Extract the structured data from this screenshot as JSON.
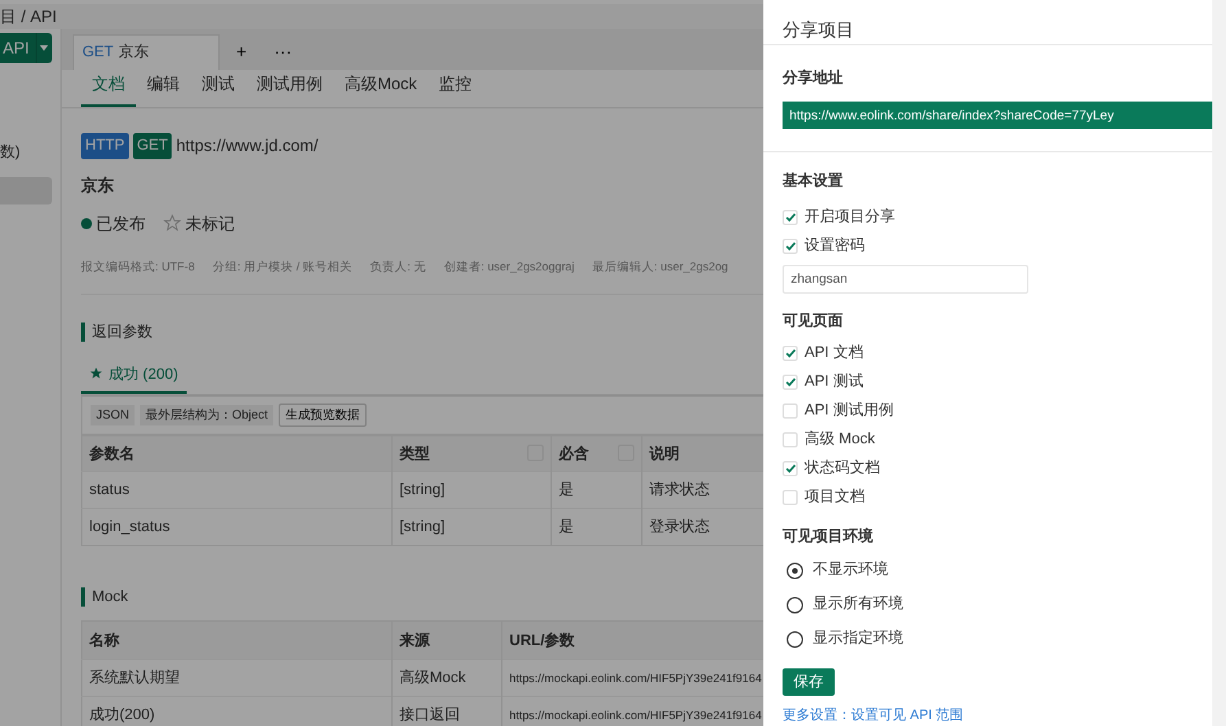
{
  "breadcrumb": "目 / API",
  "sidebar": {
    "button": "API",
    "items": [
      {
        "label": "数)",
        "selected": false
      },
      {
        "selected": true
      }
    ]
  },
  "doc_tabs": [
    {
      "method": "GET",
      "title": "京东",
      "selected": true
    }
  ],
  "tab_actions": [
    "+",
    "···"
  ],
  "sub_tabs": [
    {
      "label": "文档",
      "selected": true
    },
    {
      "label": "编辑",
      "selected": false
    },
    {
      "label": "测试",
      "selected": false
    },
    {
      "label": "测试用例",
      "selected": false
    },
    {
      "label": "高级Mock",
      "selected": false
    },
    {
      "label": "监控",
      "selected": false
    }
  ],
  "api": {
    "protocol": "HTTP",
    "method": "GET",
    "url": "https://www.jd.com/",
    "name": "京东",
    "status": "已发布",
    "star": "未标记",
    "starred": false,
    "meta": [
      "报文编码格式: UTF-8",
      "分组: 用户模块 / 账号相关",
      "负责人: 无",
      "创建者: user_2gs2oggraj",
      "最后编辑人: user_2gs2og"
    ]
  },
  "response": {
    "title": "返回参数",
    "tabs": [
      {
        "label": "成功 (200)",
        "selected": true
      }
    ],
    "tags": [
      "JSON",
      "最外层结构为：Object"
    ],
    "button": "生成预览数据",
    "columns": [
      {
        "label": "参数名",
        "sortable": false
      },
      {
        "label": "类型",
        "sortable": true
      },
      {
        "label": "必含",
        "sortable": true
      },
      {
        "label": "说明",
        "sortable": false
      }
    ],
    "rows": [
      [
        "status",
        "[string]",
        "是",
        "请求状态"
      ],
      [
        "login_status",
        "[string]",
        "是",
        "登录状态"
      ]
    ]
  },
  "mock": {
    "title": "Mock",
    "columns": [
      "名称",
      "来源",
      "URL/参数"
    ],
    "rows": [
      [
        "系统默认期望",
        "高级Mock",
        "https://mockapi.eolink.com/HIF5PjY39e241f9164"
      ],
      [
        "成功(200)",
        "接口返回",
        "https://mockapi.eolink.com/HIF5PjY39e241f9164"
      ]
    ]
  },
  "drawer": {
    "title": "分享项目",
    "address_label": "分享地址",
    "address": "https://www.eolink.com/share/index?shareCode=77yLey",
    "basic_title": "基本设置",
    "basic": [
      {
        "label": "开启项目分享",
        "checked": true
      },
      {
        "label": "设置密码",
        "checked": true
      }
    ],
    "password": "zhangsan",
    "pages_title": "可见页面",
    "pages": [
      {
        "label": "API 文档",
        "checked": true
      },
      {
        "label": "API 测试",
        "checked": true
      },
      {
        "label": "API 测试用例",
        "checked": false
      },
      {
        "label": "高级 Mock",
        "checked": false
      },
      {
        "label": "状态码文档",
        "checked": true
      },
      {
        "label": "项目文档",
        "checked": false
      }
    ],
    "env_title": "可见项目环境",
    "envs": [
      {
        "label": "不显示环境",
        "selected": true
      },
      {
        "label": "显示所有环境",
        "selected": false
      },
      {
        "label": "显示指定环境",
        "selected": false
      }
    ],
    "save": "保存",
    "more_link": "更多设置：设置可见 API 范围"
  }
}
